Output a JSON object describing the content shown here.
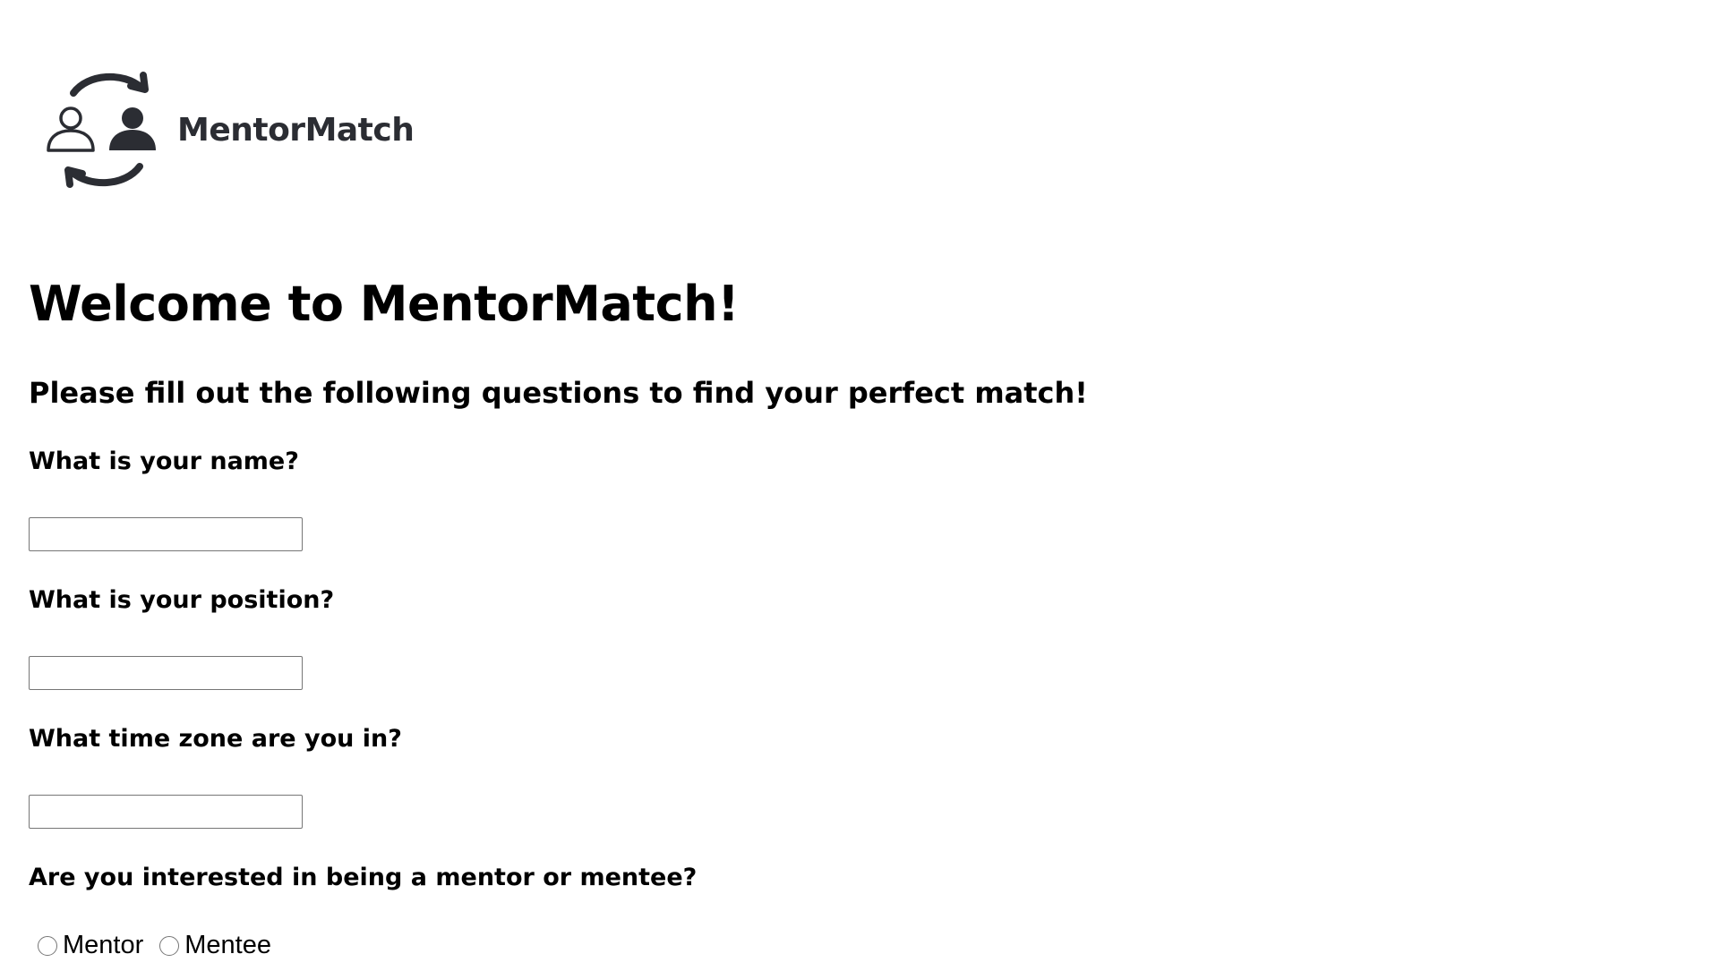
{
  "logo": {
    "text": "MentorMatch",
    "icon": "mentor-swap-people-icon",
    "color": "#2b2d33"
  },
  "heading": {
    "title": "Welcome to MentorMatch!",
    "subtitle": "Please fill out the following questions to find your perfect match!"
  },
  "form": {
    "name": {
      "label": "What is your name?",
      "value": ""
    },
    "position": {
      "label": "What is your position?",
      "value": ""
    },
    "timezone": {
      "label": "What time zone are you in?",
      "value": ""
    },
    "role": {
      "label": "Are you interested in being a mentor or mentee?",
      "options": [
        "Mentor",
        "Mentee"
      ],
      "selected": null
    }
  }
}
